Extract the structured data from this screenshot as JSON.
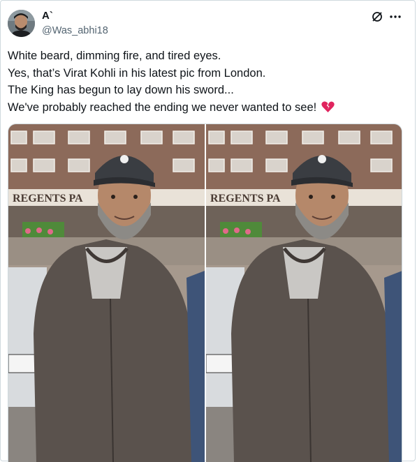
{
  "tweet": {
    "display_name": "A`",
    "handle": "@Was_abhi18",
    "lines": [
      "White beard, dimming fire, and tired eyes.",
      "Yes, that’s Virat Kohli in his latest pic from London.",
      "The King has begun to lay down his sword...",
      "We've probably reached the ending we never wanted to see!"
    ],
    "emoji": "broken-heart"
  },
  "media": {
    "photos": [
      {
        "sign_text": "REGENTS PA"
      },
      {
        "sign_text": "REGENTS PA"
      }
    ]
  },
  "icons": {
    "grok": "grok-icon",
    "more": "more-icon"
  },
  "colors": {
    "text": "#0f1419",
    "secondary": "#536471",
    "border": "#cfd9de",
    "heart": "#e0245e"
  }
}
